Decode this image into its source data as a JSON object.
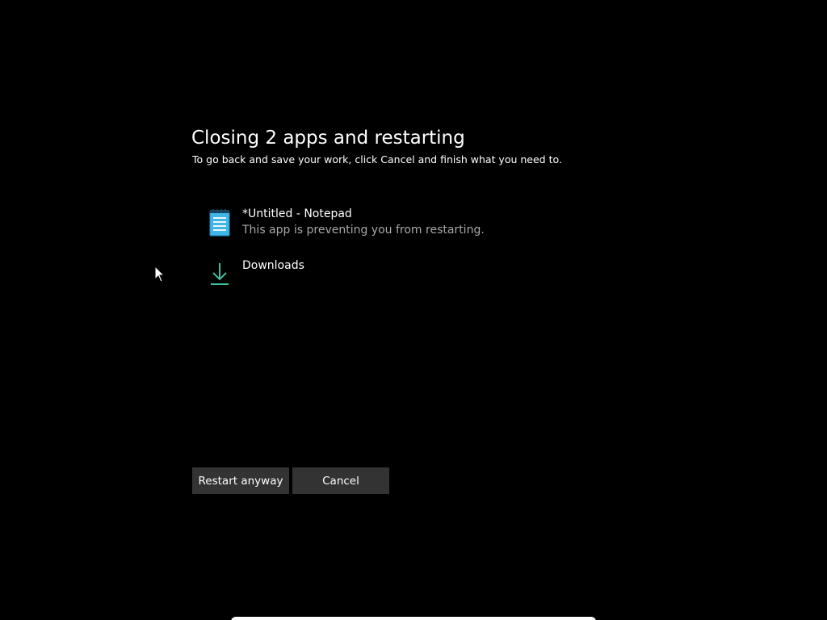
{
  "dialog": {
    "title": "Closing 2 apps and restarting",
    "subtitle": "To go back and save your work, click Cancel and finish what you need to."
  },
  "apps": [
    {
      "name": "*Untitled - Notepad",
      "description": "This app is preventing you from restarting.",
      "icon": "notepad-icon"
    },
    {
      "name": "Downloads",
      "description": "",
      "icon": "download-arrow-icon"
    }
  ],
  "buttons": {
    "restart_label": "Restart anyway",
    "cancel_label": "Cancel"
  },
  "colors": {
    "background": "#000000",
    "button_bg": "#333333",
    "secondary_text": "#a8a8a8",
    "notepad_accent": "#3fb6e6",
    "download_accent": "#3fbf9f"
  }
}
